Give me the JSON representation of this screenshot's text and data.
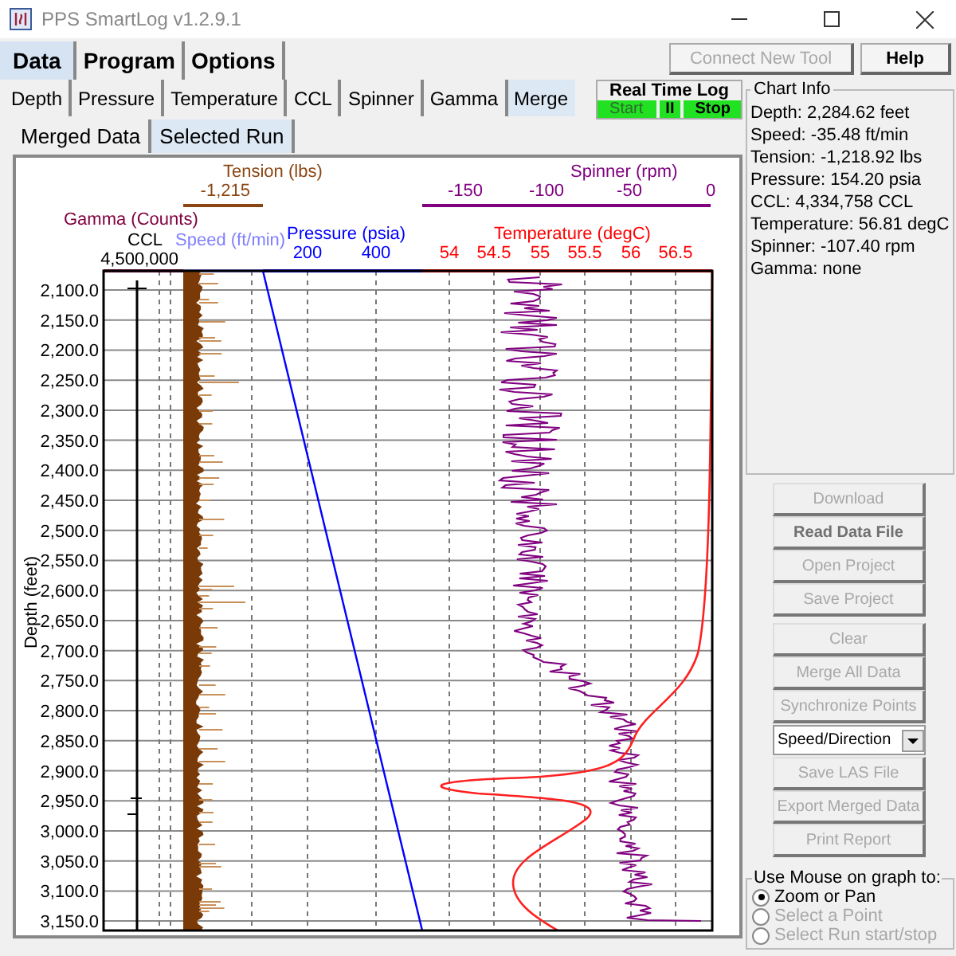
{
  "window": {
    "title": "PPS SmartLog v1.2.9.1"
  },
  "main_tabs": [
    {
      "label": "Data",
      "selected": true
    },
    {
      "label": "Program",
      "selected": false
    },
    {
      "label": "Options",
      "selected": false
    }
  ],
  "toolbar_buttons": [
    {
      "label": "Connect New Tool",
      "disabled": true
    },
    {
      "label": "Help",
      "disabled": false
    }
  ],
  "data_tabs": [
    {
      "label": "Depth",
      "selected": false
    },
    {
      "label": "Pressure",
      "selected": false
    },
    {
      "label": "Temperature",
      "selected": false
    },
    {
      "label": "CCL",
      "selected": false
    },
    {
      "label": "Spinner",
      "selected": false
    },
    {
      "label": "Gamma",
      "selected": false
    },
    {
      "label": "Merge",
      "selected": true
    }
  ],
  "real_time_log": {
    "title": "Real Time Log",
    "buttons": [
      {
        "label": "Start",
        "disabled": true
      },
      {
        "label": "II",
        "disabled": false
      },
      {
        "label": "Stop",
        "disabled": false
      }
    ]
  },
  "sub_tabs": [
    {
      "label": "Merged Data",
      "selected": false
    },
    {
      "label": "Selected Run",
      "selected": true
    }
  ],
  "log_chart": {
    "depth_title": "Depth (feet)",
    "depth_ticks": [
      "2,100.0",
      "2,150.0",
      "2,200.0",
      "2,250.0",
      "2,300.0",
      "2,350.0",
      "2,400.0",
      "2,450.0",
      "2,500.0",
      "2,550.0",
      "2,600.0",
      "2,650.0",
      "2,700.0",
      "2,750.0",
      "2,800.0",
      "2,850.0",
      "2,900.0",
      "2,950.0",
      "3,000.0",
      "3,050.0",
      "3,100.0",
      "3,150.0"
    ],
    "curves": [
      {
        "title": "Tension (lbs)",
        "color": "#8b4513",
        "ticks": [
          "-1,215"
        ]
      },
      {
        "title": "Spinner (rpm)",
        "color": "#800080",
        "ticks": [
          "-150",
          "-100",
          "-50",
          "0"
        ]
      },
      {
        "title": "Gamma (Counts)",
        "color": "#800040"
      },
      {
        "title": "CCL",
        "color": "#000000",
        "ticks": [
          "4,500,000"
        ]
      },
      {
        "title": "Speed (ft/min)",
        "color": "#8080ff"
      },
      {
        "title": "Pressure (psia)",
        "color": "#0000ff",
        "ticks": [
          "200",
          "400"
        ]
      },
      {
        "title": "Temperature (degC)",
        "color": "#ff0000",
        "ticks": [
          "54",
          "54.5",
          "55",
          "55.5",
          "56",
          "56.5"
        ]
      }
    ]
  },
  "chart_info": {
    "title": "Chart Info",
    "lines": [
      "Depth: 2,284.62 feet",
      "Speed: -35.48 ft/min",
      "Tension: -1,218.92 lbs",
      "Pressure: 154.20 psia",
      "CCL: 4,334,758 CCL",
      "Temperature: 56.81 degC",
      "Spinner: -107.40 rpm",
      "Gamma: none"
    ]
  },
  "actions": [
    {
      "kind": "button",
      "label": "Download",
      "disabled": true
    },
    {
      "kind": "button",
      "label": "Read Data File",
      "disabled": false
    },
    {
      "kind": "button",
      "label": "Open Project",
      "disabled": true
    },
    {
      "kind": "button",
      "label": "Save Project",
      "disabled": true
    },
    {
      "kind": "gap"
    },
    {
      "kind": "button",
      "label": "Clear",
      "disabled": true
    },
    {
      "kind": "button",
      "label": "Merge All Data",
      "disabled": true
    },
    {
      "kind": "button",
      "label": "Synchronize Points",
      "disabled": true
    },
    {
      "kind": "dropdown",
      "label": "Speed/Direction",
      "disabled": false
    },
    {
      "kind": "button",
      "label": "Save LAS File",
      "disabled": true
    },
    {
      "kind": "button",
      "label": "Export Merged Data",
      "disabled": true
    },
    {
      "kind": "button",
      "label": "Print Report",
      "disabled": true
    }
  ],
  "mouse_mode": {
    "title": "Use Mouse on graph to:",
    "options": [
      {
        "label": "Zoom or Pan",
        "selected": true,
        "disabled": false
      },
      {
        "label": "Select a Point",
        "selected": false,
        "disabled": true
      },
      {
        "label": "Select Run start/stop",
        "selected": false,
        "disabled": true
      }
    ]
  }
}
